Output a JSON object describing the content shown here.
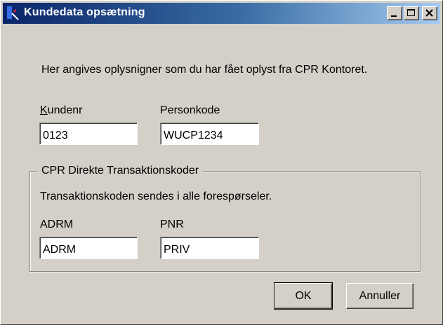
{
  "window": {
    "title": "Kundedata opsætning",
    "icon": "cpr-app-icon",
    "controls": {
      "minimize": "minimize-icon",
      "maximize": "maximize-icon",
      "close": "close-icon"
    }
  },
  "intro_text": "Her angives oplysnigner som du har fået oplyst fra CPR Kontoret.",
  "customer": {
    "kundenr_label_accel": "K",
    "kundenr_label_rest": "undenr",
    "kundenr_value": "0123",
    "personkode_label": "Personkode",
    "personkode_value": "WUCP1234"
  },
  "transaction_group": {
    "legend": "CPR Direkte Transaktionskoder",
    "description": "Transaktionskoden sendes i alle forespørseler.",
    "adrm_label": "ADRM",
    "adrm_value": "ADRM",
    "pnr_label": "PNR",
    "pnr_value": "PRIV"
  },
  "buttons": {
    "ok": "OK",
    "cancel": "Annuller"
  },
  "colors": {
    "face": "#d4d0c8",
    "titlebar_start": "#0a246a",
    "titlebar_end": "#a6caf0",
    "title_text": "#ffffff"
  }
}
